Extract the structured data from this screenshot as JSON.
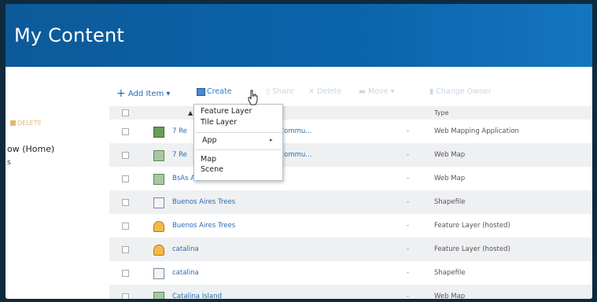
{
  "header": {
    "title": "My Content"
  },
  "sidebar": {
    "delete_label": "DELETE",
    "folder_home": "ow (Home)",
    "folder_sub": "s"
  },
  "toolbar": {
    "add_item": "Add Item",
    "create": "Create",
    "share": "Share",
    "delete": "Delete",
    "move": "Move",
    "change_owner": "Change Owner"
  },
  "create_menu": {
    "feature_layer": "Feature Layer",
    "tile_layer": "Tile Layer",
    "app": "App",
    "map": "Map",
    "scene": "Scene"
  },
  "table": {
    "header_title": "T",
    "header_type": "Type",
    "rows": [
      {
        "title": "7 Re",
        "title_tail": "d by the Mapillary Commu...",
        "dash": "-",
        "type": "Web Mapping Application",
        "icon": "web-app-icon"
      },
      {
        "title": "7 Re",
        "title_tail": "d by the Mapillary Commu...",
        "dash": "-",
        "type": "Web Map",
        "icon": "web-map-icon"
      },
      {
        "title": "BsAs Arboles",
        "title_tail": "",
        "dash": "-",
        "type": "Web Map",
        "icon": "web-map-icon"
      },
      {
        "title": "Buenos Aires Trees",
        "title_tail": "",
        "dash": "-",
        "type": "Shapefile",
        "icon": "file-icon"
      },
      {
        "title": "Buenos Aires Trees",
        "title_tail": "",
        "dash": "-",
        "type": "Feature Layer (hosted)",
        "icon": "feature-layer-icon"
      },
      {
        "title": "catalina",
        "title_tail": "",
        "dash": "-",
        "type": "Feature Layer (hosted)",
        "icon": "feature-layer-icon"
      },
      {
        "title": "catalina",
        "title_tail": "",
        "dash": "-",
        "type": "Shapefile",
        "icon": "file-icon"
      },
      {
        "title": "Catalina Island",
        "title_tail": "",
        "dash": "-",
        "type": "Web Map",
        "icon": "web-map-icon"
      }
    ]
  },
  "colors": {
    "banner": "#0b64ab",
    "link": "#2b6cb0",
    "row_alt": "#eff0f2"
  }
}
